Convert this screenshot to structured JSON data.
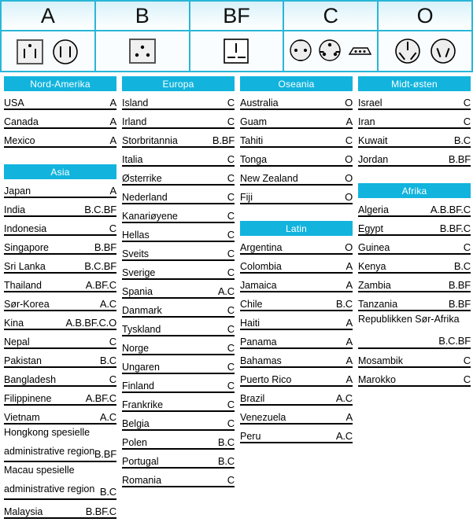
{
  "plug_table": {
    "columns": [
      {
        "label": "A",
        "icon_names": [
          "socket-a-square-icon",
          "socket-a-round-icon"
        ]
      },
      {
        "label": "B",
        "icon_names": [
          "socket-b-square-icon"
        ]
      },
      {
        "label": "BF",
        "icon_names": [
          "socket-bf-square-icon"
        ]
      },
      {
        "label": "C",
        "icon_names": [
          "socket-c-round-icon",
          "socket-c-round-grounded-icon",
          "socket-c-flat-icon"
        ]
      },
      {
        "label": "O",
        "icon_names": [
          "socket-o-round-three-icon",
          "socket-o-round-two-icon"
        ]
      }
    ]
  },
  "accent_color": "#12b4dd",
  "columns": [
    {
      "groups": [
        {
          "title": "Nord-Amerika",
          "rows": [
            {
              "name": "USA",
              "types": "A"
            },
            {
              "name": "Canada",
              "types": "A"
            },
            {
              "name": "Mexico",
              "types": "A"
            }
          ]
        },
        {
          "title": "Asia",
          "rows": [
            {
              "name": "Japan",
              "types": "A"
            },
            {
              "name": "India",
              "types": "B.C.BF"
            },
            {
              "name": "Indonesia",
              "types": "C"
            },
            {
              "name": "Singapore",
              "types": "B.BF"
            },
            {
              "name": "Sri Lanka",
              "types": "B.C.BF"
            },
            {
              "name": "Thailand",
              "types": "A.BF.C"
            },
            {
              "name": "Sør-Korea",
              "types": "A.C"
            },
            {
              "name": "Kina",
              "types": "A.B.BF.C.O"
            },
            {
              "name": "Nepal",
              "types": "C"
            },
            {
              "name": "Pakistan",
              "types": "B.C"
            },
            {
              "name": "Bangladesh",
              "types": "C"
            },
            {
              "name": "Filippinene",
              "types": "A.BF.C"
            },
            {
              "name": "Vietnam",
              "types": "A.C"
            },
            {
              "name": "Hongkong spesielle",
              "name2": "administrative region",
              "types": "B.BF"
            },
            {
              "name": "Macau spesielle",
              "name2": "administrative region",
              "types": "B.C"
            },
            {
              "name": "Malaysia",
              "types": "B.BF.C"
            }
          ]
        }
      ]
    },
    {
      "groups": [
        {
          "title": "Europa",
          "rows": [
            {
              "name": "Island",
              "types": "C"
            },
            {
              "name": "Irland",
              "types": "C"
            },
            {
              "name": "Storbritannia",
              "types": "B.BF"
            },
            {
              "name": "Italia",
              "types": "C"
            },
            {
              "name": "Østerrike",
              "types": "C"
            },
            {
              "name": "Nederland",
              "types": "C"
            },
            {
              "name": "Kanariøyene",
              "types": "C"
            },
            {
              "name": "Hellas",
              "types": "C"
            },
            {
              "name": "Sveits",
              "types": "C"
            },
            {
              "name": "Sverige",
              "types": "C"
            },
            {
              "name": "Spania",
              "types": "A.C"
            },
            {
              "name": "Danmark",
              "types": "C"
            },
            {
              "name": "Tyskland",
              "types": "C"
            },
            {
              "name": "Norge",
              "types": "C"
            },
            {
              "name": "Ungaren",
              "types": "C"
            },
            {
              "name": "Finland",
              "types": "C"
            },
            {
              "name": "Frankrike",
              "types": "C"
            },
            {
              "name": "Belgia",
              "types": "C"
            },
            {
              "name": "Polen",
              "types": "B.C"
            },
            {
              "name": "Portugal",
              "types": "B.C"
            },
            {
              "name": "Romania",
              "types": "C"
            }
          ]
        }
      ]
    },
    {
      "groups": [
        {
          "title": "Oseania",
          "rows": [
            {
              "name": "Australia",
              "types": "O"
            },
            {
              "name": "Guam",
              "types": "A"
            },
            {
              "name": "Tahiti",
              "types": "C"
            },
            {
              "name": "Tonga",
              "types": "O"
            },
            {
              "name": "New Zealand",
              "types": "O"
            },
            {
              "name": "Fiji",
              "types": "O"
            }
          ]
        },
        {
          "title": "Latin",
          "rows": [
            {
              "name": "Argentina",
              "types": "O"
            },
            {
              "name": "Colombia",
              "types": "A"
            },
            {
              "name": "Jamaica",
              "types": "A"
            },
            {
              "name": "Chile",
              "types": "B.C"
            },
            {
              "name": "Haiti",
              "types": "A"
            },
            {
              "name": "Panama",
              "types": "A"
            },
            {
              "name": "Bahamas",
              "types": "A"
            },
            {
              "name": "Puerto Rico",
              "types": "A"
            },
            {
              "name": "Brazil",
              "types": "A.C"
            },
            {
              "name": "Venezuela",
              "types": "A"
            },
            {
              "name": "Peru",
              "types": "A.C"
            }
          ]
        }
      ]
    },
    {
      "groups": [
        {
          "title": "Midt-østen",
          "rows": [
            {
              "name": "Israel",
              "types": "C"
            },
            {
              "name": "Iran",
              "types": "C"
            },
            {
              "name": "Kuwait",
              "types": "B.C"
            },
            {
              "name": "Jordan",
              "types": "B.BF"
            }
          ]
        },
        {
          "title": "Afrika",
          "rows": [
            {
              "name": "Algeria",
              "types": "A.B.BF.C"
            },
            {
              "name": "Egypt",
              "types": "B.BF.C"
            },
            {
              "name": "Guinea",
              "types": "C"
            },
            {
              "name": "Kenya",
              "types": "B.C"
            },
            {
              "name": "Zambia",
              "types": "B.BF"
            },
            {
              "name": "Tanzania",
              "types": "B.BF"
            },
            {
              "name": "Republikken Sør-Afrika",
              "name2": "",
              "types": "B.C.BF"
            },
            {
              "name": "Mosambik",
              "types": "C"
            },
            {
              "name": "Marokko",
              "types": "C"
            }
          ]
        }
      ]
    }
  ]
}
